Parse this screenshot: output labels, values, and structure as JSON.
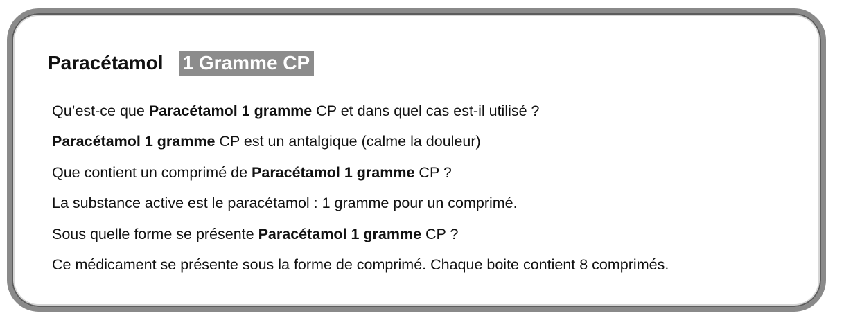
{
  "title": {
    "name": "Paracétamol",
    "badge": "1 Gramme CP"
  },
  "lines": [
    {
      "seg1": "Qu’est-ce que ",
      "bold": "Paracétamol 1 gramme",
      "seg2": " CP et dans quel cas est-il utilisé ?"
    },
    {
      "seg1": "",
      "bold": "Paracétamol 1 gramme",
      "seg2": " CP est un antalgique (calme la douleur)"
    },
    {
      "seg1": "Que contient un comprimé de  ",
      "bold": "Paracétamol 1 gramme",
      "seg2": " CP ?"
    },
    {
      "text": "La substance active est le paracétamol : 1 gramme pour un comprimé."
    },
    {
      "seg1": "Sous quelle forme se présente ",
      "bold": "Paracétamol 1 gramme",
      "seg2": " CP ?"
    },
    {
      "text": "Ce médicament se présente sous la forme de comprimé. Chaque boite contient 8 comprimés."
    }
  ]
}
